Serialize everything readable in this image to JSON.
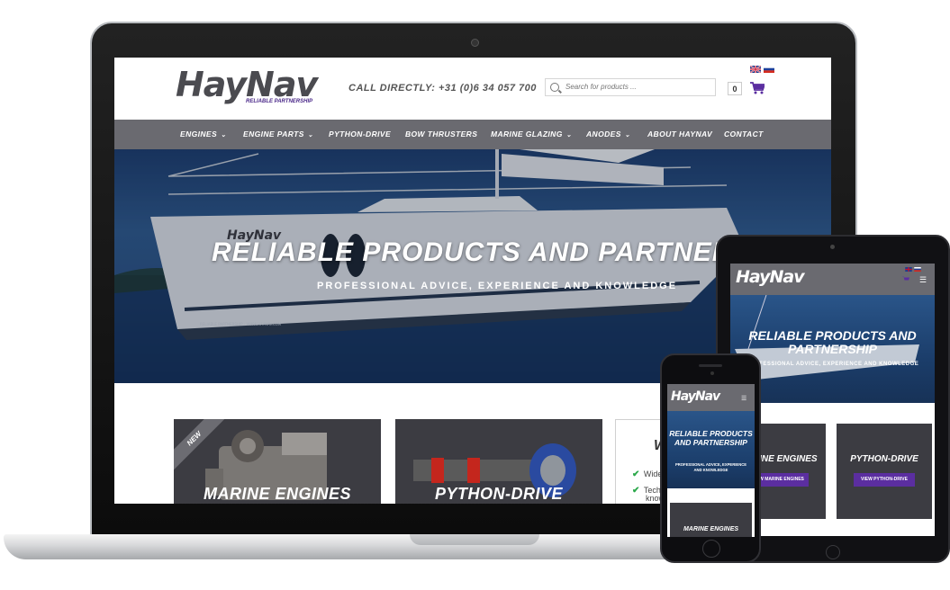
{
  "site": {
    "logo": "HayNav",
    "tagline": "RELIABLE PARTNERSHIP",
    "call_prefix": "CALL DIRECTLY:",
    "phone": "+31 (0)6 34 057 700",
    "search_placeholder": "Search for products ...",
    "cart_count": "0",
    "languages": [
      "English",
      "Russian"
    ]
  },
  "nav": {
    "items": [
      {
        "label": "ENGINES",
        "has_dropdown": true
      },
      {
        "label": "ENGINE PARTS",
        "has_dropdown": true
      },
      {
        "label": "PYTHON-DRIVE",
        "has_dropdown": false
      },
      {
        "label": "BOW THRUSTERS",
        "has_dropdown": false
      },
      {
        "label": "MARINE GLAZING",
        "has_dropdown": true
      },
      {
        "label": "ANODES",
        "has_dropdown": true
      },
      {
        "label": "ABOUT HAYNAV",
        "has_dropdown": false
      },
      {
        "label": "CONTACT",
        "has_dropdown": false
      }
    ]
  },
  "hero": {
    "title": "RELIABLE PRODUCTS AND PARTNERSHIP",
    "title_tablet": "RELIABLE PRODUCTS AND PARTNERSHIP",
    "title_phone": "RELIABLE PRODUCTS AND PARTNERSHIP",
    "subtitle": "PROFESSIONAL ADVICE, EXPERIENCE AND KNOWLEDGE",
    "subtitle_phone": "PROFESSIONAL ADVICE, EXPERIENCE AND KNOWLEDGE",
    "boat_name": "HayNav",
    "boat_hull_text": "RELIABLE PARTNERSHIP - WWW.HAYNAV.COM"
  },
  "cards": [
    {
      "label": "MARINE ENGINES",
      "ribbon": "NEW",
      "button": "VIEW MARINE ENGINES"
    },
    {
      "label": "PYTHON-DRIVE",
      "button": "VIEW PYTHON-DRIVE"
    }
  ],
  "why_box": {
    "title_fragment": "W",
    "lines": [
      "Wide",
      "Tech",
      "know"
    ]
  },
  "colors": {
    "nav_bg": "#6a6a70",
    "accent_purple": "#5b2ea0",
    "check_green": "#2aa84a",
    "logo_gray": "#4b4b50"
  }
}
